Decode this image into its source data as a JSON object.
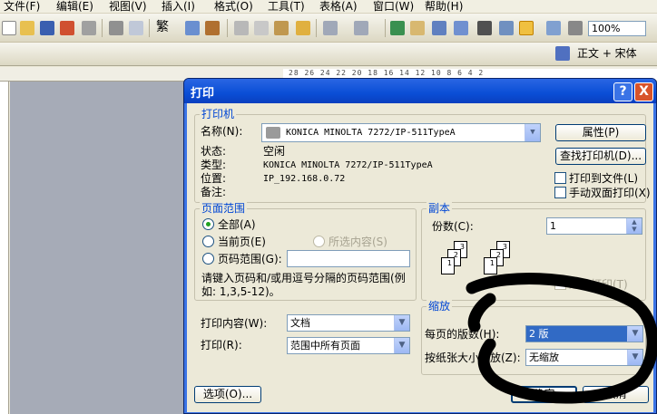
{
  "menubar": {
    "items": [
      "文件(F)",
      "编辑(E)",
      "视图(V)",
      "插入(I)",
      "格式(O)",
      "工具(T)",
      "表格(A)",
      "窗口(W)",
      "帮助(H)"
    ]
  },
  "toolbar": {
    "format_glyph": "繁",
    "zoom": "100%",
    "style": "正文 + 宋体"
  },
  "ruler": {
    "numbers": "28 26 24 22 20 18 16 14 12 10 8 6 4 2"
  },
  "dialog": {
    "title": "打印",
    "help": "?",
    "close": "X",
    "printer": {
      "legend": "打印机",
      "name_label": "名称(N):",
      "name_value": "KONICA MINOLTA 7272/IP-511TypeA",
      "status_label": "状态:",
      "status_value": "空闲",
      "type_label": "类型:",
      "type_value": "KONICA MINOLTA 7272/IP-511TypeA",
      "location_label": "位置:",
      "location_value": "IP_192.168.0.72",
      "comment_label": "备注:",
      "properties": "属性(P)",
      "find": "查找打印机(D)...",
      "print_to_file": "打印到文件(L)",
      "manual_duplex": "手动双面打印(X)"
    },
    "range": {
      "legend": "页面范围",
      "all": "全部(A)",
      "current": "当前页(E)",
      "selection": "所选内容(S)",
      "pages": "页码范围(G):",
      "pages_value": "",
      "hint": "请键入页码和/或用逗号分隔的页码范围(例如: 1,3,5-12)。"
    },
    "copies": {
      "legend": "副本",
      "count_label": "份数(C):",
      "count_value": "1",
      "collate": "逐份打印(T)"
    },
    "print_what_label": "打印内容(W):",
    "print_what": "文档",
    "print_label": "打印(R):",
    "print": "范围中所有页面",
    "zoom": {
      "legend": "缩放",
      "pages_per_sheet_label": "每页的版数(H):",
      "pages_per_sheet": "2 版",
      "scale_label": "按纸张大小缩放(Z):",
      "scale": "无缩放"
    },
    "options": "选项(O)...",
    "ok": "确定",
    "cancel": "取消"
  }
}
